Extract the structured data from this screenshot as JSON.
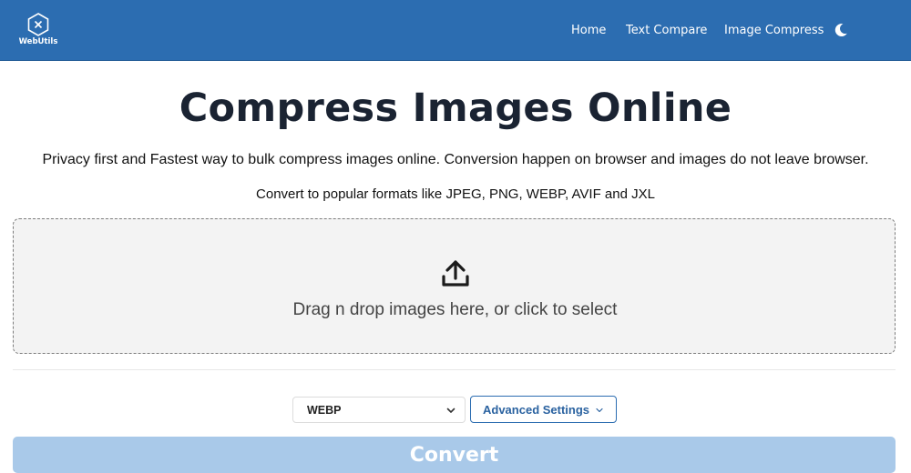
{
  "header": {
    "brand_name": "WebUtils",
    "brand_icon": "webutils-logo-icon",
    "nav": [
      {
        "label": "Home"
      },
      {
        "label": "Text Compare"
      },
      {
        "label": "Image Compress"
      }
    ],
    "theme_icon": "moon-icon"
  },
  "main": {
    "title": "Compress Images Online",
    "subtitle": "Privacy first and Fastest way to bulk compress images online. Conversion happen on browser and images do not leave browser.",
    "formats_text": "Convert to popular formats like JPEG, PNG, WEBP, AVIF and JXL",
    "dropzone": {
      "icon": "upload-icon",
      "text": "Drag n drop images here, or click to select"
    },
    "format_select": {
      "value": "WEBP"
    },
    "advanced_button": {
      "label": "Advanced Settings"
    },
    "convert_button": {
      "label": "Convert"
    }
  },
  "colors": {
    "header_bg": "#2c6db1",
    "dropzone_bg": "#f3f3f3",
    "convert_bg": "#a9c9e9",
    "accent": "#2c6db1"
  }
}
